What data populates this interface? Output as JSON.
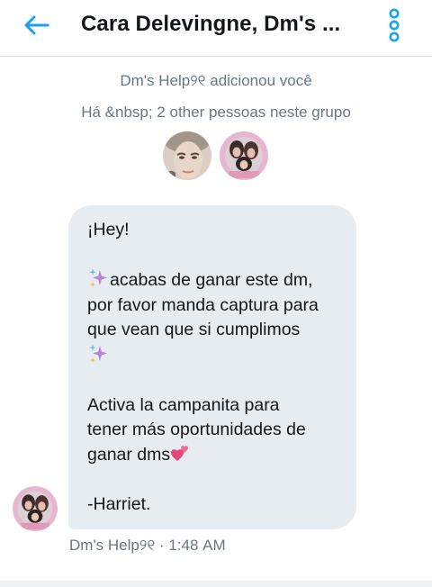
{
  "header": {
    "title": "Cara Delevingne, Dm's ...",
    "back_icon": "arrow-left-icon",
    "more_icon": "vertical-dots-icon",
    "accent_color": "#1da1f2"
  },
  "system_messages": [
    "Dm's Help୨୧ adicionou você",
    "Há &nbsp; 2 other pessoas neste grupo"
  ],
  "group_avatars": [
    "member-avatar-1",
    "member-avatar-2"
  ],
  "message": {
    "lines": [
      "¡Hey!",
      "acabas de ganar este dm,",
      "por favor manda captura para",
      "que vean que si cumplimos",
      "Activa la campanita para",
      "tener más oportunidades de",
      "ganar dms",
      "-Harriet."
    ],
    "bubble_color": "#e6ecf0"
  },
  "meta": {
    "sender": "Dm's Help୨୧",
    "separator": "·",
    "time": "1:48 AM"
  }
}
